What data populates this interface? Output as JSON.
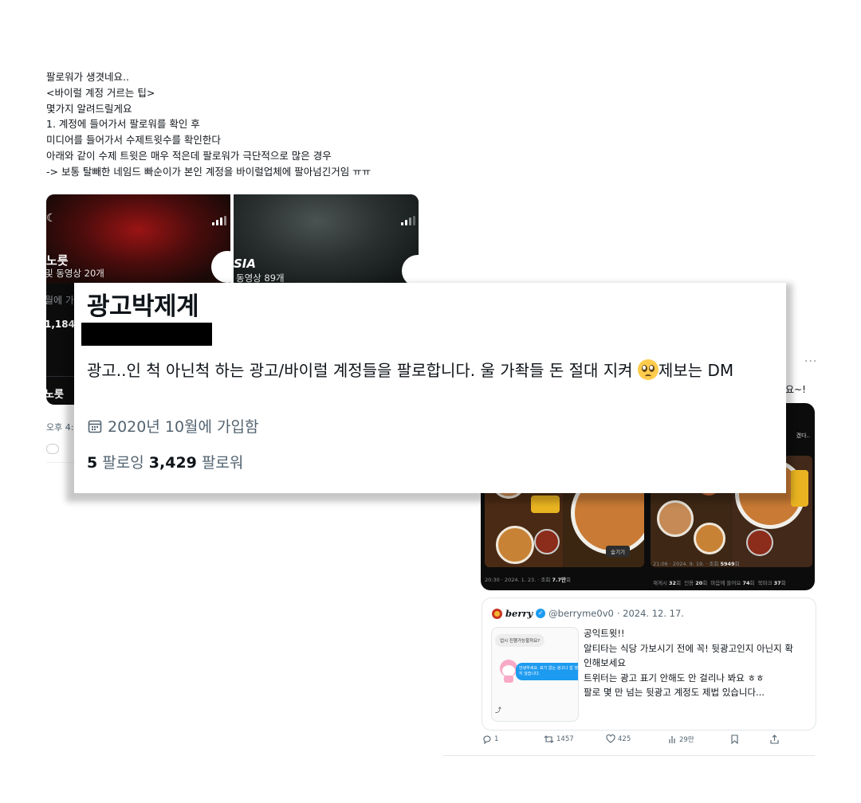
{
  "intro_lines": [
    "팔로워가 생겻네요..",
    "<바이럴 계정 거르는 팁>",
    "몇가지 알려드릴게요",
    "1. 계정에 들어가서 팔로워를 확인 후",
    "미디어를 들어가서 수제트윗수를 확인한다",
    "아래와 같이 수제 트윗은 매우 적은데 팔로워가 극단적으로 많은 경우",
    "-> 보통 탈빼한 네임드 빠순이가 본인 계정을 바이럴업체에 팔아넘긴거임 ㅠㅠ"
  ],
  "screenshot_a": {
    "name": "노릇",
    "media": "및 동영상 20개",
    "bio_fragment": "월에 가",
    "count": "1,184",
    "footer_name": "노릇"
  },
  "screenshot_b": {
    "name": "SIA",
    "media": "동영상 89개"
  },
  "left_meta": "오후 4:",
  "right_cut": {
    "ellipsis": "···",
    "trail": "요~!",
    "top_right": "겠다.."
  },
  "profile": {
    "name": "광고박제계",
    "bio_main": "광고..인 척 아닌척 하는 광고/바이럴 계정들을 팔로합니다. 울 가좍들 돈 절대 지켜",
    "bio_after_emoji": "제보는 DM",
    "emoji_icon": "pleading-face",
    "joined": "2020년 10월에 가입함",
    "following_count": "5",
    "following_label": "팔로잉",
    "followers_count": "3,429",
    "followers_label": "팔로워"
  },
  "food_card": {
    "left_meta_time": "20:30 · 2024. 1. 23. · 조회",
    "left_meta_views": "7.7만",
    "left_meta_suffix": "회",
    "hide_label": "숨기기",
    "right_meta_time": "21:06 · 2024. 9. 19. · 조회",
    "right_meta_views": "5949",
    "right_meta_suffix": "회",
    "right_stats": [
      {
        "label": "재게시",
        "value": "32",
        "unit": "회"
      },
      {
        "label": "인용",
        "value": "20",
        "unit": "회"
      },
      {
        "label": "마음에 들어요",
        "value": "74",
        "unit": "회"
      },
      {
        "label": "북마크",
        "value": "37",
        "unit": "회"
      }
    ]
  },
  "quote": {
    "name": "berry",
    "handle": "@berryme0v0",
    "date": "· 2024. 12. 17.",
    "thumb_gray": "업시 진행가능할까요?",
    "thumb_blue": "안녕하세요. 표기 없는 광고나 힘 행하지 않습니다.",
    "body": [
      "공익트윗!!",
      "알티타는 식당 가보시기 전에 꼭! 뒷광고인지 아닌지 확",
      "인해보세요",
      "트위터는 광고 표기 안해도 안 걸리나 봐요 ㅎㅎ",
      "팔로 몇 만 넘는 뒷광고 계정도 제법 있습니다..."
    ]
  },
  "actions": {
    "replies": "1",
    "retweets": "1457",
    "likes": "425",
    "views": "29만"
  }
}
